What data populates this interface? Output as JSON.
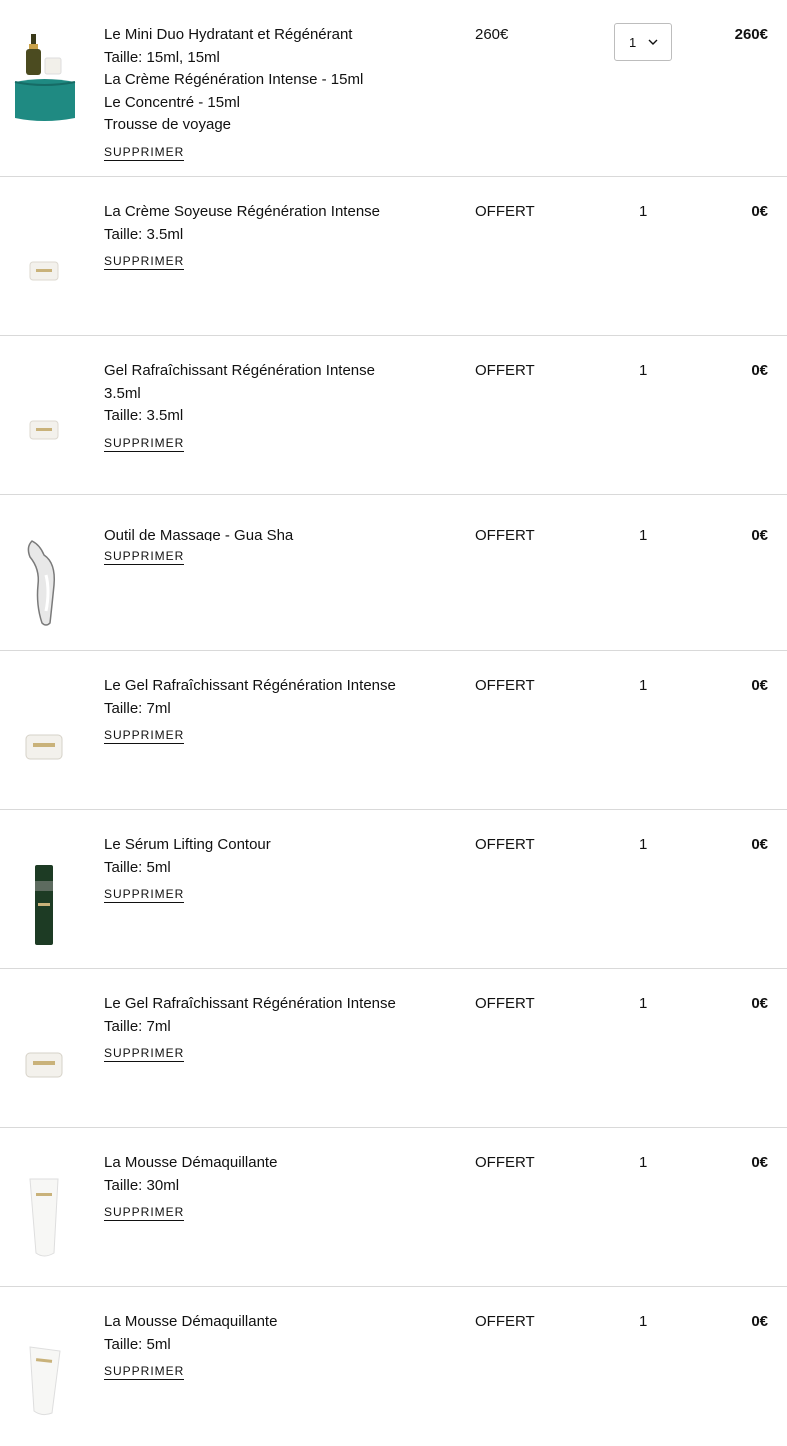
{
  "remove_label": "SUPPRIMER",
  "items": [
    {
      "lines": [
        "Le Mini Duo Hydratant et Régénérant",
        "Taille: 15ml, 15ml",
        "La Crème Régénération Intense - 15ml",
        "Le Concentré - 15ml",
        "Trousse de voyage"
      ],
      "price": "260€",
      "quantity": "1",
      "total": "260€",
      "image": "duo-kit-pouch"
    },
    {
      "lines": [
        "La Crème Soyeuse Régénération Intense",
        "Taille: 3.5ml"
      ],
      "price": "OFFERT",
      "quantity": "1",
      "total": "0€",
      "image": "small-jar"
    },
    {
      "lines": [
        "Gel Rafraîchissant Régénération Intense",
        "3.5ml",
        "Taille: 3.5ml"
      ],
      "price": "OFFERT",
      "quantity": "1",
      "total": "0€",
      "image": "small-jar"
    },
    {
      "lines": [
        "Outil de Massage - Gua Sha"
      ],
      "price": "OFFERT",
      "quantity": "1",
      "total": "0€",
      "image": "gua-sha"
    },
    {
      "lines": [
        "Le Gel Rafraîchissant Régénération Intense",
        "Taille: 7ml"
      ],
      "price": "OFFERT",
      "quantity": "1",
      "total": "0€",
      "image": "jar"
    },
    {
      "lines": [
        "Le Sérum Lifting Contour",
        "Taille: 5ml"
      ],
      "price": "OFFERT",
      "quantity": "1",
      "total": "0€",
      "image": "serum-bottle"
    },
    {
      "lines": [
        "Le Gel Rafraîchissant Régénération Intense",
        "Taille: 7ml"
      ],
      "price": "OFFERT",
      "quantity": "1",
      "total": "0€",
      "image": "jar"
    },
    {
      "lines": [
        "La Mousse Démaquillante",
        "Taille: 30ml"
      ],
      "price": "OFFERT",
      "quantity": "1",
      "total": "0€",
      "image": "tube"
    },
    {
      "lines": [
        "La Mousse Démaquillante",
        "Taille: 5ml"
      ],
      "price": "OFFERT",
      "quantity": "1",
      "total": "0€",
      "image": "small-tube"
    }
  ]
}
